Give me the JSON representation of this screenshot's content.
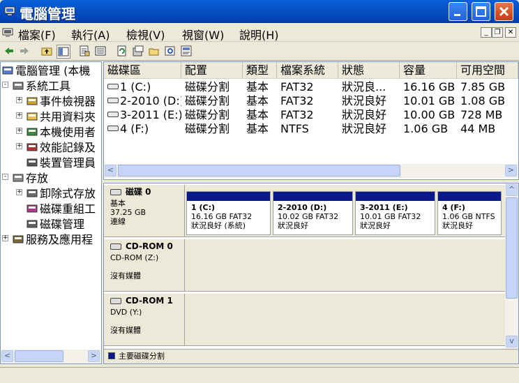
{
  "window": {
    "title": "電腦管理"
  },
  "menu": {
    "items": [
      "檔案(F)",
      "執行(A)",
      "檢視(V)",
      "視窗(W)",
      "說明(H)"
    ]
  },
  "toolbar": {
    "buttons": [
      "back-icon",
      "forward-icon",
      "up-icon",
      "show-tree-icon",
      "properties-icon",
      "view-icon",
      "refresh-icon",
      "export-icon",
      "open-icon",
      "search-icon",
      "help-icon"
    ]
  },
  "tree": {
    "items": [
      {
        "label": "電腦管理 (本機",
        "level": 0,
        "expander": "",
        "icon": "computer-management-icon"
      },
      {
        "label": "系統工具",
        "level": 1,
        "expander": "−",
        "icon": "system-tools-icon"
      },
      {
        "label": "事件檢視器",
        "level": 2,
        "expander": "+",
        "icon": "event-viewer-icon"
      },
      {
        "label": "共用資料夾",
        "level": 2,
        "expander": "+",
        "icon": "shared-folders-icon"
      },
      {
        "label": "本機使用者",
        "level": 2,
        "expander": "+",
        "icon": "local-users-icon"
      },
      {
        "label": "效能記錄及",
        "level": 2,
        "expander": "+",
        "icon": "performance-logs-icon"
      },
      {
        "label": "裝置管理員",
        "level": 2,
        "expander": "",
        "icon": "device-manager-icon"
      },
      {
        "label": "存放",
        "level": 1,
        "expander": "−",
        "icon": "storage-icon"
      },
      {
        "label": "卸除式存放",
        "level": 2,
        "expander": "+",
        "icon": "removable-storage-icon"
      },
      {
        "label": "磁碟重組工",
        "level": 2,
        "expander": "",
        "icon": "defragmenter-icon"
      },
      {
        "label": "磁碟管理",
        "level": 2,
        "expander": "",
        "icon": "disk-management-icon"
      },
      {
        "label": "服務及應用程",
        "level": 1,
        "expander": "+",
        "icon": "services-icon"
      }
    ]
  },
  "volumes": {
    "columns": [
      "磁碟區",
      "配置",
      "類型",
      "檔案系統",
      "狀態",
      "容量",
      "可用空間"
    ],
    "rows": [
      [
        "1 (C:)",
        "磁碟分割",
        "基本",
        "FAT32",
        "狀況良...",
        "16.16 GB",
        "7.85 GB"
      ],
      [
        "2-2010 (D:)",
        "磁碟分割",
        "基本",
        "FAT32",
        "狀況良好",
        "10.01 GB",
        "1.08 GB"
      ],
      [
        "3-2011 (E:)",
        "磁碟分割",
        "基本",
        "FAT32",
        "狀況良好",
        "10.00 GB",
        "728 MB"
      ],
      [
        "4 (F:)",
        "磁碟分割",
        "基本",
        "NTFS",
        "狀況良好",
        "1.06 GB",
        "44 MB"
      ]
    ]
  },
  "disks": [
    {
      "name": "磁碟 0",
      "type": "基本",
      "size": "37.25 GB",
      "status": "連線",
      "partitions": [
        {
          "title": "1  (C:)",
          "info": "16.16 GB FAT32",
          "status": "狀況良好 (系統)"
        },
        {
          "title": "2-2010  (D:)",
          "info": "10.02 GB FAT32",
          "status": "狀況良好"
        },
        {
          "title": "3-2011  (E:)",
          "info": "10.01 GB FAT32",
          "status": "狀況良好"
        },
        {
          "title": "4  (F:)",
          "info": "1.06 GB NTFS",
          "status": "狀況良好"
        }
      ]
    },
    {
      "name": "CD-ROM 0",
      "type": "CD-ROM (Z:)",
      "status": "沒有媒體"
    },
    {
      "name": "CD-ROM 1",
      "type": "DVD (Y:)",
      "status": "沒有媒體"
    }
  ],
  "legend": {
    "primary_partition": "主要磁碟分割"
  },
  "colors": {
    "titlebar": "#0553c6",
    "partition_bar": "#0a1a8a",
    "background": "#ece9d8"
  }
}
